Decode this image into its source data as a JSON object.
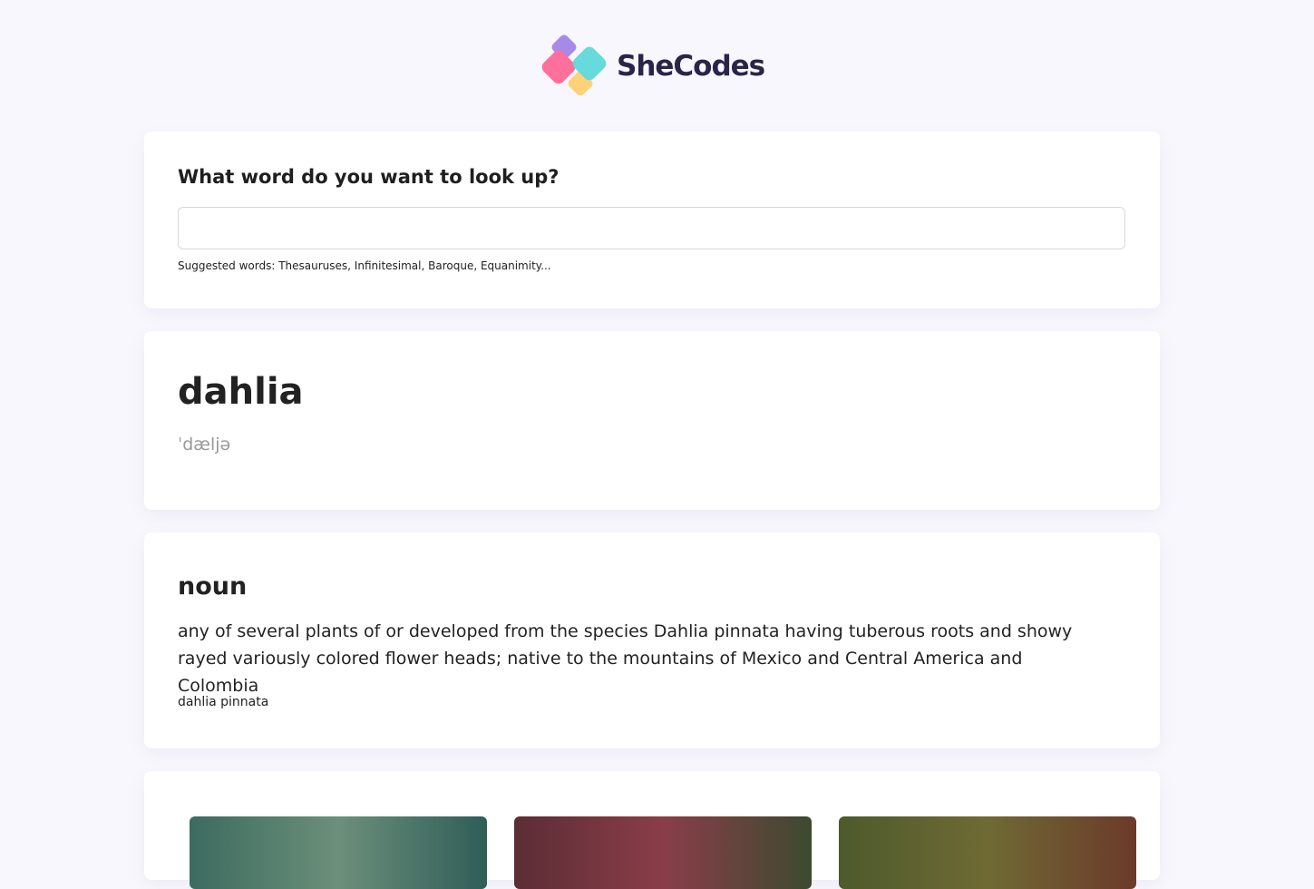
{
  "brand": {
    "name": "SheCodes",
    "colors": {
      "purple": "#a68ae8",
      "pink": "#ff6f9c",
      "cyan": "#5fd8dc",
      "yellow": "#ffd27a",
      "text": "#2b2448"
    }
  },
  "search": {
    "title": "What word do you want to look up?",
    "value": "",
    "placeholder": "",
    "suggested": "Suggested words: Thesauruses, Infinitesimal, Baroque, Equanimity..."
  },
  "word": {
    "text": "dahlia",
    "phonetic": "ˈdæljə"
  },
  "meaning": {
    "part_of_speech": "noun",
    "definition": "any of several plants of or developed from the species Dahlia pinnata having tuberous roots and showy rayed variously colored flower heads; native to the mountains of Mexico and Central America and Colombia",
    "synonym": "dahlia pinnata"
  },
  "photos": {
    "items": [
      "photo-1",
      "photo-2",
      "photo-3"
    ]
  }
}
